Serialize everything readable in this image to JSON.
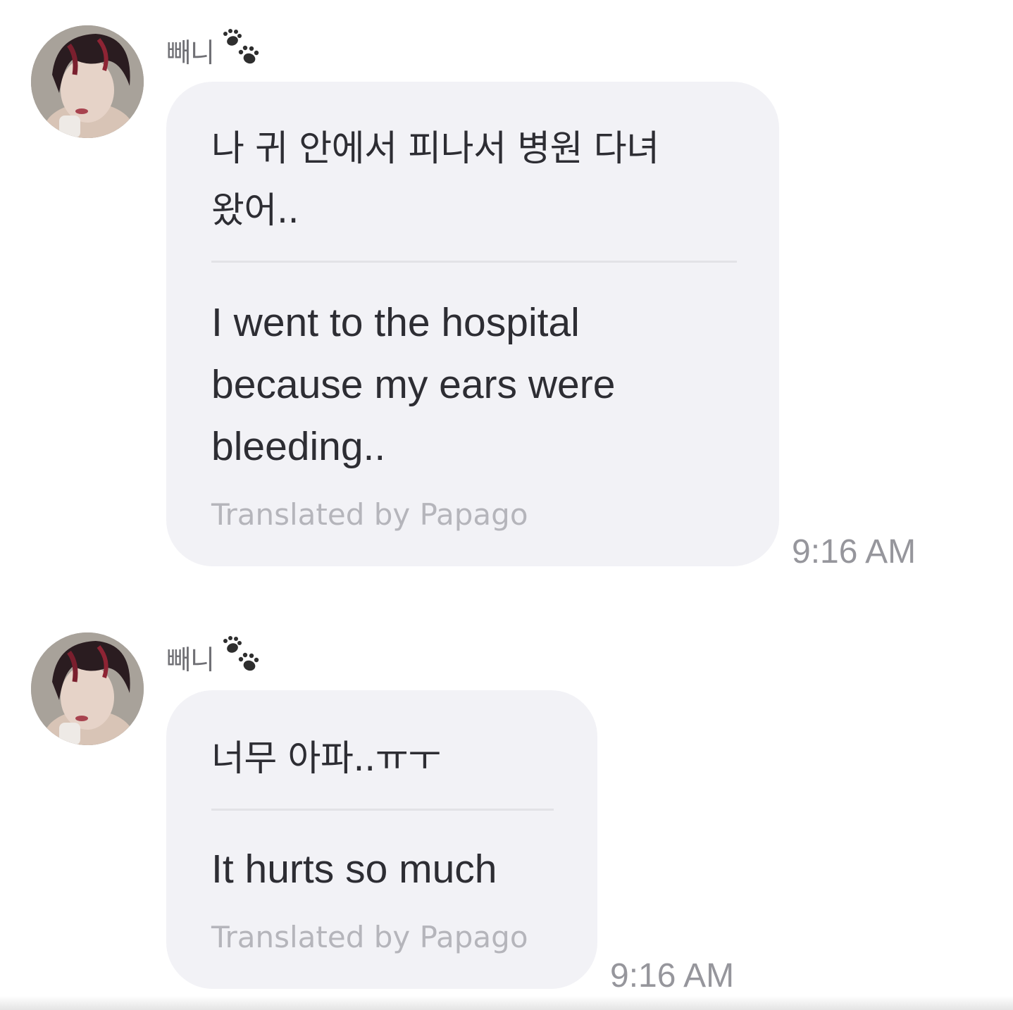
{
  "messages": [
    {
      "sender": "빼니",
      "sender_icon": "paw-prints-icon",
      "avatar": "profile-photo-avatar",
      "original_lines": [
        "나 귀 안에서 피나서 병원 다녀",
        "왔어.."
      ],
      "translation_lines": [
        "I went to the hospital",
        "because my ears were",
        "bleeding.."
      ],
      "credit": "Translated by Papago",
      "time": "9:16 AM"
    },
    {
      "sender": "빼니",
      "sender_icon": "paw-prints-icon",
      "avatar": "profile-photo-avatar",
      "original_lines": [
        "너무 아파..ㅠㅜ"
      ],
      "translation_lines": [
        "It hurts so much"
      ],
      "credit": "Translated by Papago",
      "time": "9:16 AM"
    }
  ],
  "colors": {
    "bubble": "#f2f2f6",
    "text": "#2d2d33",
    "credit": "#b5b5bb",
    "timestamp": "#96969c",
    "sender": "#707075"
  }
}
